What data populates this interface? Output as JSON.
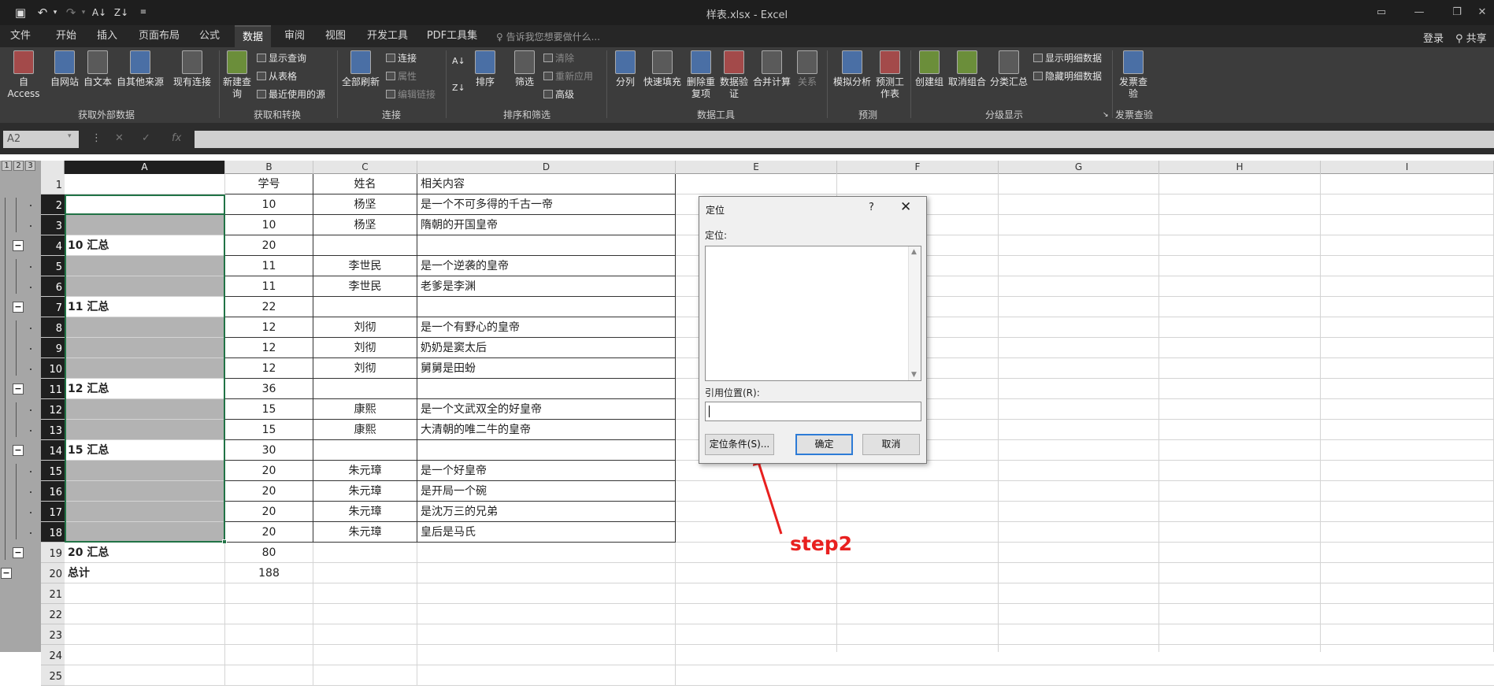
{
  "window": {
    "title": "样表.xlsx - Excel",
    "login": "登录",
    "share": "共享",
    "tell_me": "告诉我您想要做什么..."
  },
  "tabs": [
    "文件",
    "开始",
    "插入",
    "页面布局",
    "公式",
    "数据",
    "审阅",
    "视图",
    "开发工具",
    "PDF工具集"
  ],
  "active_tab": "数据",
  "ribbon": {
    "groups": [
      {
        "name": "获取外部数据",
        "items": [
          "自 Access",
          "自网站",
          "自文本",
          "自其他来源",
          "现有连接"
        ]
      },
      {
        "name": "获取和转换",
        "items": [
          "新建查询",
          "显示查询",
          "从表格",
          "最近使用的源"
        ]
      },
      {
        "name": "连接",
        "items": [
          "全部刷新",
          "连接",
          "属性",
          "编辑链接"
        ]
      },
      {
        "name": "排序和筛选",
        "items": [
          "排序",
          "筛选",
          "清除",
          "重新应用",
          "高级"
        ]
      },
      {
        "name": "数据工具",
        "items": [
          "分列",
          "快速填充",
          "删除重复项",
          "数据验证",
          "合并计算",
          "关系"
        ]
      },
      {
        "name": "预测",
        "items": [
          "模拟分析",
          "预测工作表"
        ]
      },
      {
        "name": "分级显示",
        "items": [
          "创建组",
          "取消组合",
          "分类汇总",
          "显示明细数据",
          "隐藏明细数据"
        ]
      },
      {
        "name": "发票查验",
        "items": [
          "发票查验"
        ]
      }
    ]
  },
  "formula_bar": {
    "name_box": "A2",
    "formula": ""
  },
  "outline_levels": [
    "1",
    "2",
    "3"
  ],
  "columns": [
    "A",
    "B",
    "C",
    "D",
    "E",
    "F",
    "G",
    "H",
    "I"
  ],
  "selected_column": "A",
  "rows": [
    {
      "n": "1",
      "a": "",
      "b": "学号",
      "c": "姓名",
      "d": "相关内容"
    },
    {
      "n": "2",
      "a": "",
      "b": "10",
      "c": "杨坚",
      "d": "是一个不可多得的千古一帝"
    },
    {
      "n": "3",
      "a": "",
      "b": "10",
      "c": "杨坚",
      "d": "隋朝的开国皇帝"
    },
    {
      "n": "4",
      "a": "10 汇总",
      "b": "20",
      "c": "",
      "d": ""
    },
    {
      "n": "5",
      "a": "",
      "b": "11",
      "c": "李世民",
      "d": "是一个逆袭的皇帝"
    },
    {
      "n": "6",
      "a": "",
      "b": "11",
      "c": "李世民",
      "d": "老爹是李渊"
    },
    {
      "n": "7",
      "a": "11 汇总",
      "b": "22",
      "c": "",
      "d": ""
    },
    {
      "n": "8",
      "a": "",
      "b": "12",
      "c": "刘彻",
      "d": "是一个有野心的皇帝"
    },
    {
      "n": "9",
      "a": "",
      "b": "12",
      "c": "刘彻",
      "d": "奶奶是窦太后"
    },
    {
      "n": "10",
      "a": "",
      "b": "12",
      "c": "刘彻",
      "d": "舅舅是田蚡"
    },
    {
      "n": "11",
      "a": "12 汇总",
      "b": "36",
      "c": "",
      "d": ""
    },
    {
      "n": "12",
      "a": "",
      "b": "15",
      "c": "康熙",
      "d": "是一个文武双全的好皇帝"
    },
    {
      "n": "13",
      "a": "",
      "b": "15",
      "c": "康熙",
      "d": "大清朝的唯二牛的皇帝"
    },
    {
      "n": "14",
      "a": "15 汇总",
      "b": "30",
      "c": "",
      "d": ""
    },
    {
      "n": "15",
      "a": "",
      "b": "20",
      "c": "朱元璋",
      "d": "是一个好皇帝"
    },
    {
      "n": "16",
      "a": "",
      "b": "20",
      "c": "朱元璋",
      "d": "是开局一个碗"
    },
    {
      "n": "17",
      "a": "",
      "b": "20",
      "c": "朱元璋",
      "d": "是沈万三的兄弟"
    },
    {
      "n": "18",
      "a": "",
      "b": "20",
      "c": "朱元璋",
      "d": "皇后是马氏"
    },
    {
      "n": "19",
      "a": "20 汇总",
      "b": "80",
      "c": "",
      "d": ""
    },
    {
      "n": "20",
      "a": "总计",
      "b": "188",
      "c": "",
      "d": ""
    },
    {
      "n": "21",
      "a": "",
      "b": "",
      "c": "",
      "d": ""
    },
    {
      "n": "22",
      "a": "",
      "b": "",
      "c": "",
      "d": ""
    },
    {
      "n": "23",
      "a": "",
      "b": "",
      "c": "",
      "d": ""
    },
    {
      "n": "24",
      "a": "",
      "b": "",
      "c": "",
      "d": ""
    },
    {
      "n": "25",
      "a": "",
      "b": "",
      "c": "",
      "d": ""
    }
  ],
  "dialog": {
    "title": "定位",
    "help": "?",
    "goto_label": "定位:",
    "reference_label": "引用位置(R):",
    "reference_value": "",
    "special_button": "定位条件(S)...",
    "ok_button": "确定",
    "cancel_button": "取消"
  },
  "annotation": {
    "label": "step2",
    "color": "#e8201f"
  }
}
